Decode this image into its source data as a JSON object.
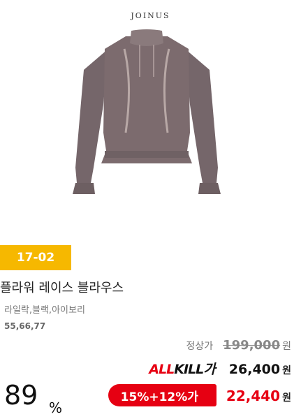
{
  "brand": "JOINUS",
  "product": {
    "code": "17-02",
    "name": "플라워 레이스 블라우스",
    "colors": "라일락,블랙,아이보리",
    "sizes": "55,66,77"
  },
  "pricing": {
    "regular_label": "정상가",
    "regular_price": "199,000",
    "allkill_label_a": "ALL",
    "allkill_label_b": "KILL",
    "allkill_label_c": "가",
    "allkill_price": "26,400",
    "discount_label": "15%+12%가",
    "final_price": "22,440",
    "currency": "원"
  },
  "discount_percent": "89",
  "percent_sign": "%",
  "colors": {
    "accent": "#e60012",
    "badge": "#f6b800",
    "garment": "#7c6b6e"
  }
}
